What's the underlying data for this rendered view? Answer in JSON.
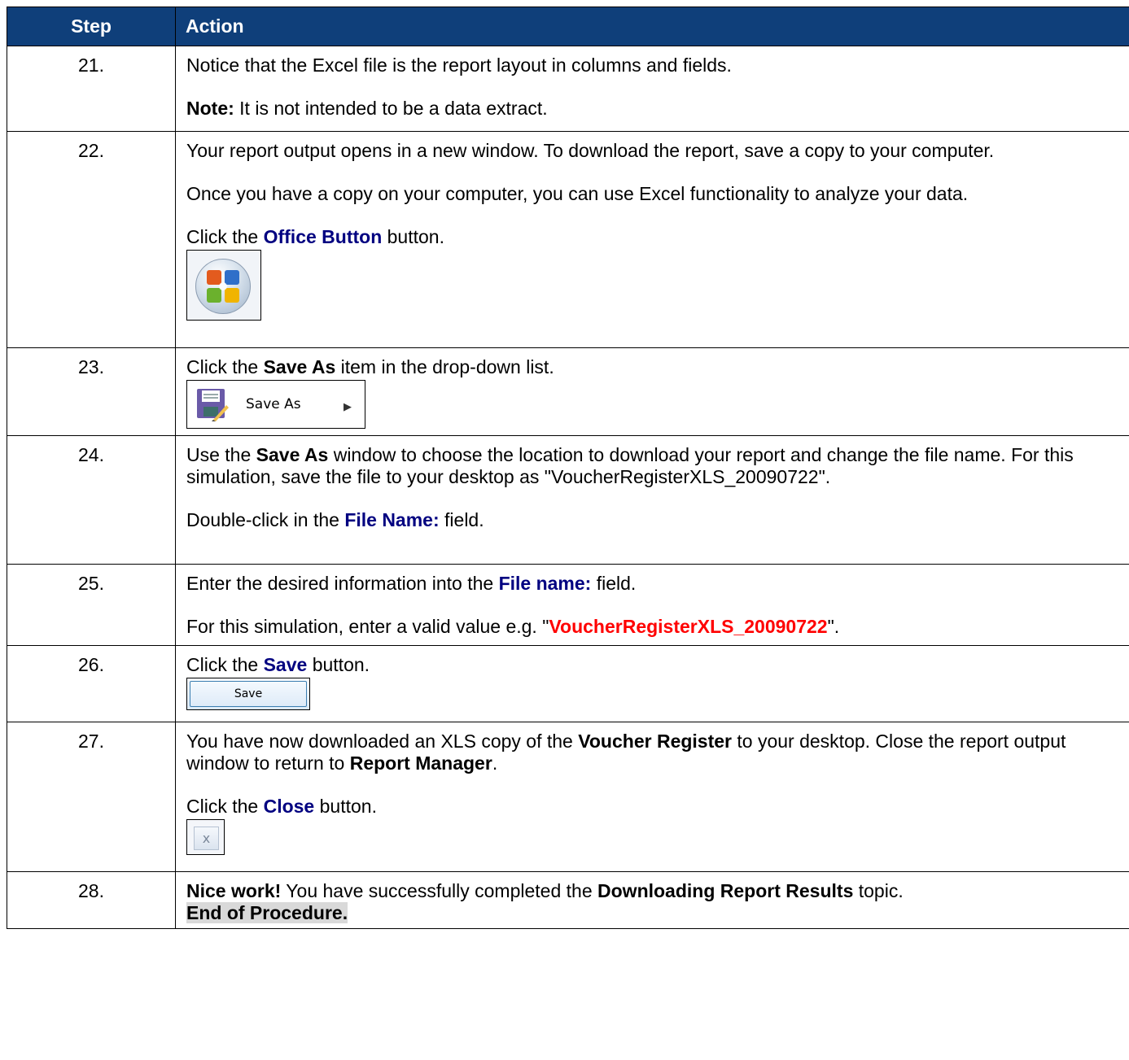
{
  "header": {
    "step": "Step",
    "action": "Action"
  },
  "rows": [
    {
      "step": "21.",
      "p1": "Notice that the Excel file is the report layout in columns and fields.",
      "p2_label": "Note:",
      "p2_text": " It is not intended to be a data extract."
    },
    {
      "step": "22.",
      "p1": "Your report output opens in a new window.  To download the report, save a copy to your computer.",
      "p2": "Once you have a copy on your computer, you can use Excel functionality to analyze your data.",
      "p3_pre": "Click the ",
      "p3_bold": "Office Button",
      "p3_post": " button."
    },
    {
      "step": "23.",
      "p1_pre": "Click the ",
      "p1_bold": "Save As",
      "p1_post": " item in the drop-down list.",
      "menu_label": "Save As"
    },
    {
      "step": "24.",
      "p1_pre": "Use the ",
      "p1_bold": "Save As",
      "p1_post": " window to choose the location to download your report and change the file name.  For this simulation, save the file to your desktop as \"VoucherRegisterXLS_20090722\".",
      "p2_pre": "Double-click in the ",
      "p2_bold": "File Name:",
      "p2_post": " field."
    },
    {
      "step": "25.",
      "p1_pre": "Enter the desired information into the ",
      "p1_bold": "File name:",
      "p1_post": " field.",
      "p2_pre": "For this simulation, enter a valid value e.g. \"",
      "p2_value": "VoucherRegisterXLS_20090722",
      "p2_post": "\"."
    },
    {
      "step": "26.",
      "p1_pre": "Click the ",
      "p1_bold": "Save",
      "p1_post": " button.",
      "button_label": "Save"
    },
    {
      "step": "27.",
      "p1_pre": "You have now downloaded an XLS copy of the ",
      "p1_bold1": "Voucher Register",
      "p1_mid": " to your desktop. Close the report output window to return to ",
      "p1_bold2": "Report Manager",
      "p1_post": ".",
      "p2_pre": "Click the ",
      "p2_bold": "Close",
      "p2_post": " button.",
      "close_glyph": "x"
    },
    {
      "step": "28.",
      "p1_bold1": "Nice work!",
      "p1_mid": "  You have successfully completed the ",
      "p1_bold2": "Downloading Report Results",
      "p1_post": " topic.",
      "end_label": "End of Procedure."
    }
  ],
  "colors": {
    "header_bg": "#0f3f7a",
    "header_text": "#ffffff",
    "link_bold": "#000080",
    "value_red": "#ff0000",
    "end_bg": "#d9d9d9"
  },
  "icons": {
    "office_button": "office-button-icon",
    "save_as": "floppy-save-as-icon",
    "close": "close-icon"
  }
}
